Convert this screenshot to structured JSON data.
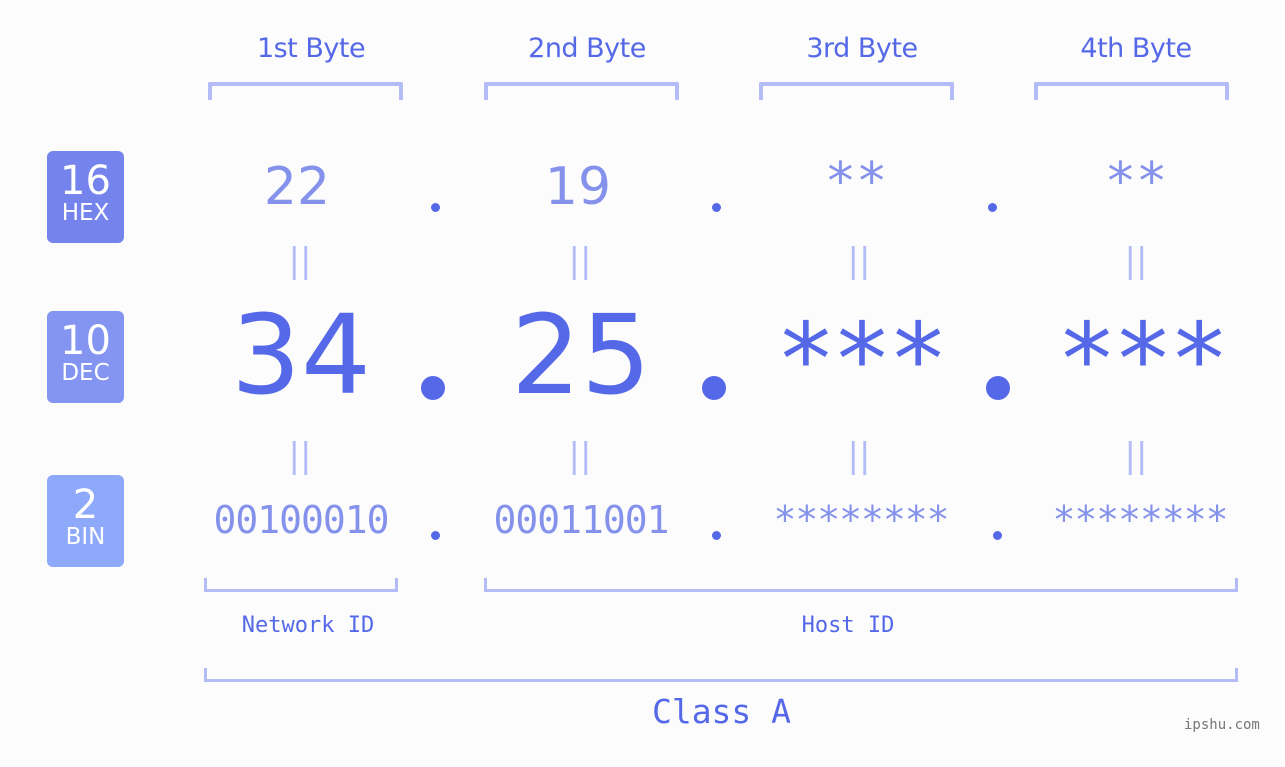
{
  "headers": [
    "1st Byte",
    "2nd Byte",
    "3rd Byte",
    "4th Byte"
  ],
  "badges": {
    "hex": {
      "base": "16",
      "label": "HEX"
    },
    "dec": {
      "base": "10",
      "label": "DEC"
    },
    "bin": {
      "base": "2",
      "label": "BIN"
    }
  },
  "hex": [
    "22",
    "19",
    "**",
    "**"
  ],
  "dec": [
    "34",
    "25",
    "***",
    "***"
  ],
  "bin": [
    "00100010",
    "00011001",
    "********",
    "********"
  ],
  "equals_symbol": "||",
  "network_id_label": "Network ID",
  "host_id_label": "Host ID",
  "class_label": "Class A",
  "watermark": "ipshu.com",
  "colors": {
    "primary": "#5468e8",
    "secondary": "#8592ec",
    "bracket": "#b3bcf6",
    "badge_hex": "#7484ec",
    "badge_dec": "#8394f1",
    "badge_bin": "#8ea8fa",
    "background": "#fbfcfb"
  }
}
